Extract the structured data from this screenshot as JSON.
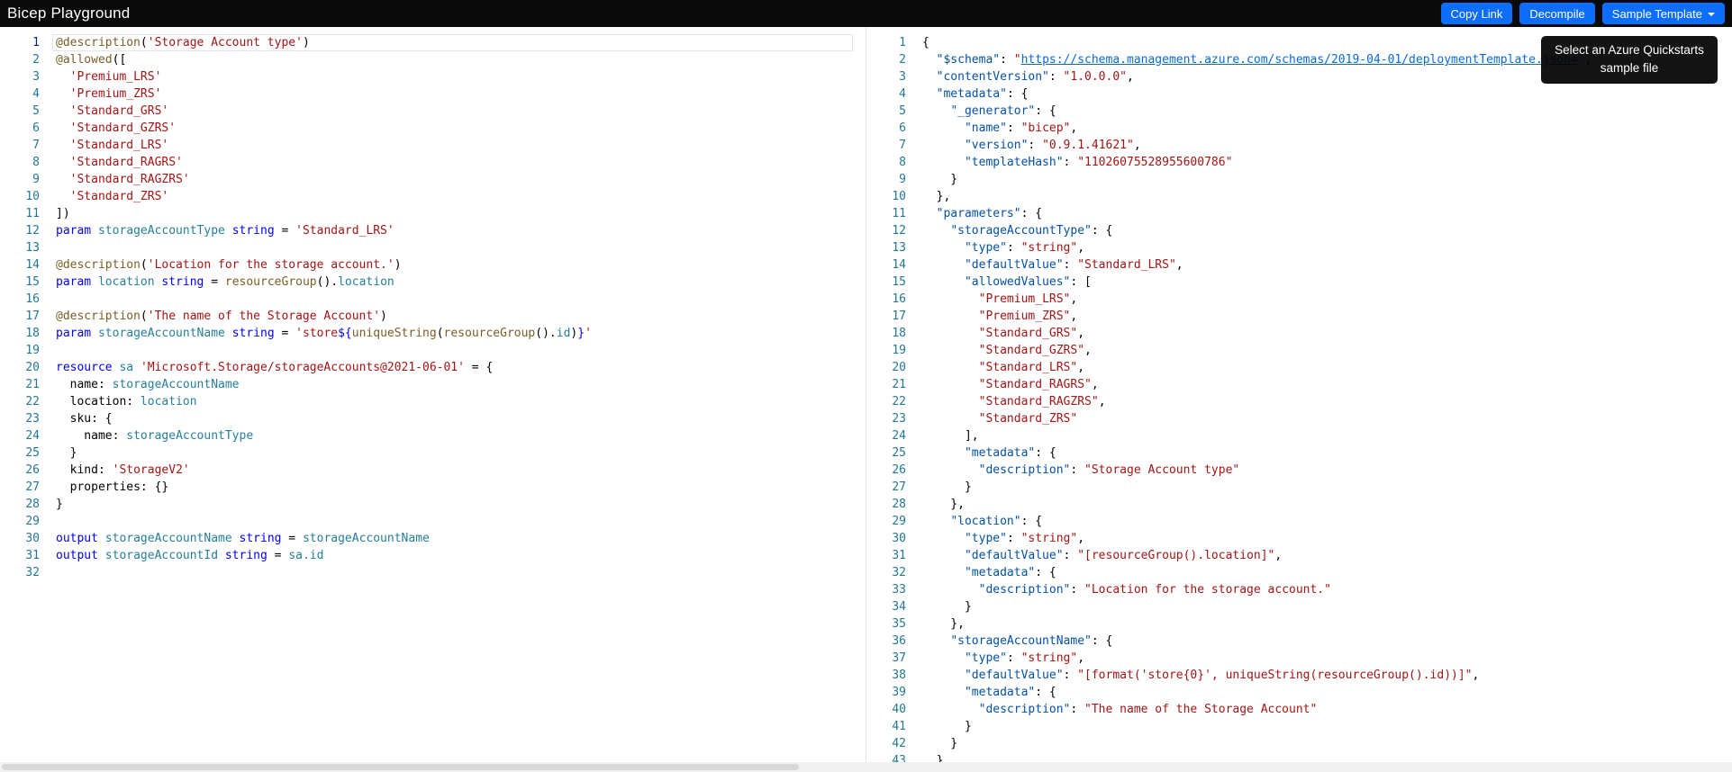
{
  "app": {
    "title": "Bicep Playground"
  },
  "header": {
    "buttons": [
      {
        "label": "Copy Link"
      },
      {
        "label": "Decompile"
      },
      {
        "label": "Sample Template"
      }
    ],
    "accent_color": "#0d6efd"
  },
  "tooltip": {
    "text": "Select an Azure Quickstarts sample file"
  },
  "left_editor": {
    "language": "bicep",
    "current_line": 1,
    "lines": [
      [
        [
          "dec",
          "@description"
        ],
        [
          "pl",
          "("
        ],
        [
          "str",
          "'Storage Account type'"
        ],
        [
          "pl",
          ")"
        ]
      ],
      [
        [
          "dec",
          "@allowed"
        ],
        [
          "pl",
          "(["
        ]
      ],
      [
        [
          "pl",
          "  "
        ],
        [
          "str",
          "'Premium_LRS'"
        ]
      ],
      [
        [
          "pl",
          "  "
        ],
        [
          "str",
          "'Premium_ZRS'"
        ]
      ],
      [
        [
          "pl",
          "  "
        ],
        [
          "str",
          "'Standard_GRS'"
        ]
      ],
      [
        [
          "pl",
          "  "
        ],
        [
          "str",
          "'Standard_GZRS'"
        ]
      ],
      [
        [
          "pl",
          "  "
        ],
        [
          "str",
          "'Standard_LRS'"
        ]
      ],
      [
        [
          "pl",
          "  "
        ],
        [
          "str",
          "'Standard_RAGRS'"
        ]
      ],
      [
        [
          "pl",
          "  "
        ],
        [
          "str",
          "'Standard_RAGZRS'"
        ]
      ],
      [
        [
          "pl",
          "  "
        ],
        [
          "str",
          "'Standard_ZRS'"
        ]
      ],
      [
        [
          "pl",
          "])"
        ]
      ],
      [
        [
          "kw",
          "param"
        ],
        [
          "pl",
          " "
        ],
        [
          "id",
          "storageAccountType"
        ],
        [
          "pl",
          " "
        ],
        [
          "ty",
          "string"
        ],
        [
          "pl",
          " = "
        ],
        [
          "str",
          "'Standard_LRS'"
        ]
      ],
      [],
      [
        [
          "dec",
          "@description"
        ],
        [
          "pl",
          "("
        ],
        [
          "str",
          "'Location for the storage account.'"
        ],
        [
          "pl",
          ")"
        ]
      ],
      [
        [
          "kw",
          "param"
        ],
        [
          "pl",
          " "
        ],
        [
          "id",
          "location"
        ],
        [
          "pl",
          " "
        ],
        [
          "ty",
          "string"
        ],
        [
          "pl",
          " = "
        ],
        [
          "fn",
          "resourceGroup"
        ],
        [
          "pl",
          "()."
        ],
        [
          "id",
          "location"
        ]
      ],
      [],
      [
        [
          "dec",
          "@description"
        ],
        [
          "pl",
          "("
        ],
        [
          "str",
          "'The name of the Storage Account'"
        ],
        [
          "pl",
          ")"
        ]
      ],
      [
        [
          "kw",
          "param"
        ],
        [
          "pl",
          " "
        ],
        [
          "id",
          "storageAccountName"
        ],
        [
          "pl",
          " "
        ],
        [
          "ty",
          "string"
        ],
        [
          "pl",
          " = "
        ],
        [
          "str",
          "'store"
        ],
        [
          "kw",
          "${"
        ],
        [
          "fn",
          "uniqueString"
        ],
        [
          "pl",
          "("
        ],
        [
          "fn",
          "resourceGroup"
        ],
        [
          "pl",
          "()."
        ],
        [
          "id",
          "id"
        ],
        [
          "pl",
          ")"
        ],
        [
          "kw",
          "}"
        ],
        [
          "str",
          "'"
        ]
      ],
      [],
      [
        [
          "kw",
          "resource"
        ],
        [
          "pl",
          " "
        ],
        [
          "id",
          "sa"
        ],
        [
          "pl",
          " "
        ],
        [
          "str",
          "'Microsoft.Storage/storageAccounts@2021-06-01'"
        ],
        [
          "pl",
          " = {"
        ]
      ],
      [
        [
          "pl",
          "  name: "
        ],
        [
          "id",
          "storageAccountName"
        ]
      ],
      [
        [
          "pl",
          "  location: "
        ],
        [
          "id",
          "location"
        ]
      ],
      [
        [
          "pl",
          "  sku: {"
        ]
      ],
      [
        [
          "pl",
          "    name: "
        ],
        [
          "id",
          "storageAccountType"
        ]
      ],
      [
        [
          "pl",
          "  }"
        ]
      ],
      [
        [
          "pl",
          "  kind: "
        ],
        [
          "str",
          "'StorageV2'"
        ]
      ],
      [
        [
          "pl",
          "  properties: {}"
        ]
      ],
      [
        [
          "pl",
          "}"
        ]
      ],
      [],
      [
        [
          "kw",
          "output"
        ],
        [
          "pl",
          " "
        ],
        [
          "id",
          "storageAccountName"
        ],
        [
          "pl",
          " "
        ],
        [
          "ty",
          "string"
        ],
        [
          "pl",
          " = "
        ],
        [
          "id",
          "storageAccountName"
        ]
      ],
      [
        [
          "kw",
          "output"
        ],
        [
          "pl",
          " "
        ],
        [
          "id",
          "storageAccountId"
        ],
        [
          "pl",
          " "
        ],
        [
          "ty",
          "string"
        ],
        [
          "pl",
          " = "
        ],
        [
          "id",
          "sa.id"
        ]
      ],
      []
    ]
  },
  "right_editor": {
    "language": "json",
    "current_line": 0,
    "lines": [
      [
        [
          "pl",
          "{"
        ]
      ],
      [
        [
          "pl",
          "  "
        ],
        [
          "key",
          "\"$schema\""
        ],
        [
          "pl",
          ": "
        ],
        [
          "val",
          "\""
        ],
        [
          "link",
          "https://schema.management.azure.com/schemas/2019-04-01/deploymentTemplate.json#"
        ],
        [
          "val",
          "\""
        ],
        [
          "pl",
          ","
        ]
      ],
      [
        [
          "pl",
          "  "
        ],
        [
          "key",
          "\"contentVersion\""
        ],
        [
          "pl",
          ": "
        ],
        [
          "val",
          "\"1.0.0.0\""
        ],
        [
          "pl",
          ","
        ]
      ],
      [
        [
          "pl",
          "  "
        ],
        [
          "key",
          "\"metadata\""
        ],
        [
          "pl",
          ": {"
        ]
      ],
      [
        [
          "pl",
          "    "
        ],
        [
          "key",
          "\"_generator\""
        ],
        [
          "pl",
          ": {"
        ]
      ],
      [
        [
          "pl",
          "      "
        ],
        [
          "key",
          "\"name\""
        ],
        [
          "pl",
          ": "
        ],
        [
          "val",
          "\"bicep\""
        ],
        [
          "pl",
          ","
        ]
      ],
      [
        [
          "pl",
          "      "
        ],
        [
          "key",
          "\"version\""
        ],
        [
          "pl",
          ": "
        ],
        [
          "val",
          "\"0.9.1.41621\""
        ],
        [
          "pl",
          ","
        ]
      ],
      [
        [
          "pl",
          "      "
        ],
        [
          "key",
          "\"templateHash\""
        ],
        [
          "pl",
          ": "
        ],
        [
          "val",
          "\"11026075528955600786\""
        ]
      ],
      [
        [
          "pl",
          "    }"
        ]
      ],
      [
        [
          "pl",
          "  },"
        ]
      ],
      [
        [
          "pl",
          "  "
        ],
        [
          "key",
          "\"parameters\""
        ],
        [
          "pl",
          ": {"
        ]
      ],
      [
        [
          "pl",
          "    "
        ],
        [
          "key",
          "\"storageAccountType\""
        ],
        [
          "pl",
          ": {"
        ]
      ],
      [
        [
          "pl",
          "      "
        ],
        [
          "key",
          "\"type\""
        ],
        [
          "pl",
          ": "
        ],
        [
          "val",
          "\"string\""
        ],
        [
          "pl",
          ","
        ]
      ],
      [
        [
          "pl",
          "      "
        ],
        [
          "key",
          "\"defaultValue\""
        ],
        [
          "pl",
          ": "
        ],
        [
          "val",
          "\"Standard_LRS\""
        ],
        [
          "pl",
          ","
        ]
      ],
      [
        [
          "pl",
          "      "
        ],
        [
          "key",
          "\"allowedValues\""
        ],
        [
          "pl",
          ": ["
        ]
      ],
      [
        [
          "pl",
          "        "
        ],
        [
          "val",
          "\"Premium_LRS\""
        ],
        [
          "pl",
          ","
        ]
      ],
      [
        [
          "pl",
          "        "
        ],
        [
          "val",
          "\"Premium_ZRS\""
        ],
        [
          "pl",
          ","
        ]
      ],
      [
        [
          "pl",
          "        "
        ],
        [
          "val",
          "\"Standard_GRS\""
        ],
        [
          "pl",
          ","
        ]
      ],
      [
        [
          "pl",
          "        "
        ],
        [
          "val",
          "\"Standard_GZRS\""
        ],
        [
          "pl",
          ","
        ]
      ],
      [
        [
          "pl",
          "        "
        ],
        [
          "val",
          "\"Standard_LRS\""
        ],
        [
          "pl",
          ","
        ]
      ],
      [
        [
          "pl",
          "        "
        ],
        [
          "val",
          "\"Standard_RAGRS\""
        ],
        [
          "pl",
          ","
        ]
      ],
      [
        [
          "pl",
          "        "
        ],
        [
          "val",
          "\"Standard_RAGZRS\""
        ],
        [
          "pl",
          ","
        ]
      ],
      [
        [
          "pl",
          "        "
        ],
        [
          "val",
          "\"Standard_ZRS\""
        ]
      ],
      [
        [
          "pl",
          "      ],"
        ]
      ],
      [
        [
          "pl",
          "      "
        ],
        [
          "key",
          "\"metadata\""
        ],
        [
          "pl",
          ": {"
        ]
      ],
      [
        [
          "pl",
          "        "
        ],
        [
          "key",
          "\"description\""
        ],
        [
          "pl",
          ": "
        ],
        [
          "val",
          "\"Storage Account type\""
        ]
      ],
      [
        [
          "pl",
          "      }"
        ]
      ],
      [
        [
          "pl",
          "    },"
        ]
      ],
      [
        [
          "pl",
          "    "
        ],
        [
          "key",
          "\"location\""
        ],
        [
          "pl",
          ": {"
        ]
      ],
      [
        [
          "pl",
          "      "
        ],
        [
          "key",
          "\"type\""
        ],
        [
          "pl",
          ": "
        ],
        [
          "val",
          "\"string\""
        ],
        [
          "pl",
          ","
        ]
      ],
      [
        [
          "pl",
          "      "
        ],
        [
          "key",
          "\"defaultValue\""
        ],
        [
          "pl",
          ": "
        ],
        [
          "val",
          "\"[resourceGroup().location]\""
        ],
        [
          "pl",
          ","
        ]
      ],
      [
        [
          "pl",
          "      "
        ],
        [
          "key",
          "\"metadata\""
        ],
        [
          "pl",
          ": {"
        ]
      ],
      [
        [
          "pl",
          "        "
        ],
        [
          "key",
          "\"description\""
        ],
        [
          "pl",
          ": "
        ],
        [
          "val",
          "\"Location for the storage account.\""
        ]
      ],
      [
        [
          "pl",
          "      }"
        ]
      ],
      [
        [
          "pl",
          "    },"
        ]
      ],
      [
        [
          "pl",
          "    "
        ],
        [
          "key",
          "\"storageAccountName\""
        ],
        [
          "pl",
          ": {"
        ]
      ],
      [
        [
          "pl",
          "      "
        ],
        [
          "key",
          "\"type\""
        ],
        [
          "pl",
          ": "
        ],
        [
          "val",
          "\"string\""
        ],
        [
          "pl",
          ","
        ]
      ],
      [
        [
          "pl",
          "      "
        ],
        [
          "key",
          "\"defaultValue\""
        ],
        [
          "pl",
          ": "
        ],
        [
          "val",
          "\"[format('store{0}', uniqueString(resourceGroup().id))]\""
        ],
        [
          "pl",
          ","
        ]
      ],
      [
        [
          "pl",
          "      "
        ],
        [
          "key",
          "\"metadata\""
        ],
        [
          "pl",
          ": {"
        ]
      ],
      [
        [
          "pl",
          "        "
        ],
        [
          "key",
          "\"description\""
        ],
        [
          "pl",
          ": "
        ],
        [
          "val",
          "\"The name of the Storage Account\""
        ]
      ],
      [
        [
          "pl",
          "      }"
        ]
      ],
      [
        [
          "pl",
          "    }"
        ]
      ],
      [
        [
          "pl",
          "  },"
        ]
      ]
    ]
  }
}
